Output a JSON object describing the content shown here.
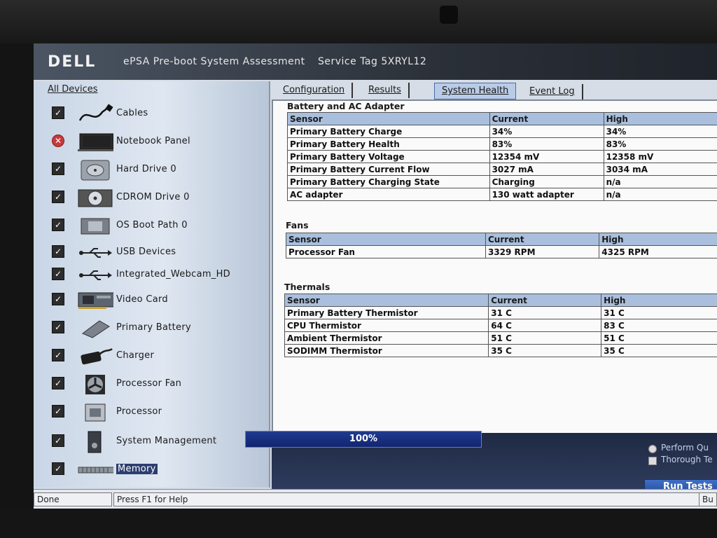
{
  "window": {
    "logo": "DELL",
    "title": "ePSA Pre-boot System Assessment",
    "service_tag": "Service Tag 5XRYL12"
  },
  "devices": {
    "header": "All Devices",
    "items": [
      {
        "label": "Cables",
        "status": "pass",
        "icon": "cable-icon"
      },
      {
        "label": "Notebook Panel",
        "status": "fail",
        "icon": "laptop-icon"
      },
      {
        "label": "Hard Drive 0",
        "status": "pass",
        "icon": "hard-drive-icon"
      },
      {
        "label": "CDROM Drive 0",
        "status": "pass",
        "icon": "cdrom-icon"
      },
      {
        "label": "OS Boot Path 0",
        "status": "pass",
        "icon": "boot-path-icon"
      },
      {
        "label": "USB Devices",
        "status": "pass",
        "icon": "usb-icon"
      },
      {
        "label": "Integrated_Webcam_HD",
        "status": "pass",
        "icon": "usb-icon"
      },
      {
        "label": "Video Card",
        "status": "pass",
        "icon": "video-card-icon"
      },
      {
        "label": "Primary Battery",
        "status": "pass",
        "icon": "battery-icon"
      },
      {
        "label": "Charger",
        "status": "pass",
        "icon": "charger-icon"
      },
      {
        "label": "Processor Fan",
        "status": "pass",
        "icon": "fan-icon"
      },
      {
        "label": "Processor",
        "status": "pass",
        "icon": "processor-icon"
      },
      {
        "label": "System Management",
        "status": "pass",
        "icon": "system-management-icon"
      },
      {
        "label": "Memory",
        "status": "pass",
        "icon": "memory-icon",
        "selected": true
      }
    ]
  },
  "tabs": [
    {
      "label": "Configuration"
    },
    {
      "label": "Results"
    },
    {
      "label": "System Health",
      "active": true
    },
    {
      "label": "Event Log"
    }
  ],
  "battery": {
    "title": "Battery and AC Adapter",
    "headers": [
      "Sensor",
      "Current",
      "High"
    ],
    "rows": [
      [
        "Primary Battery Charge",
        "34%",
        "34%"
      ],
      [
        "Primary Battery Health",
        "83%",
        "83%"
      ],
      [
        "Primary Battery Voltage",
        "12354 mV",
        "12358 mV"
      ],
      [
        "Primary Battery Current Flow",
        "3027 mA",
        "3034 mA"
      ],
      [
        "Primary Battery Charging State",
        "Charging",
        "n/a"
      ],
      [
        "AC adapter",
        "130 watt adapter",
        "n/a"
      ]
    ]
  },
  "fans": {
    "title": "Fans",
    "headers": [
      "Sensor",
      "Current",
      "High"
    ],
    "rows": [
      [
        "Processor Fan",
        "3329 RPM",
        "4325 RPM"
      ]
    ]
  },
  "thermals": {
    "title": "Thermals",
    "headers": [
      "Sensor",
      "Current",
      "High"
    ],
    "rows": [
      [
        "Primary Battery Thermistor",
        "31 C",
        "31 C"
      ],
      [
        "CPU Thermistor",
        "64 C",
        "83 C"
      ],
      [
        "Ambient Thermistor",
        "51 C",
        "51 C"
      ],
      [
        "SODIMM Thermistor",
        "35 C",
        "35 C"
      ]
    ]
  },
  "progress": {
    "label": "100%",
    "fraction": 1.0
  },
  "options": {
    "perform_quick": "Perform Qu",
    "thorough": "Thorough Te"
  },
  "run_button": "Run Tests",
  "status": {
    "left": "Done",
    "help": "Press F1 for Help",
    "right": "Bu"
  },
  "colors": {
    "selected_tab": "#b9cbe6",
    "table_header": "#a9bfdd",
    "progress_fill": "#1f3b8f",
    "fail": "#c8393b"
  }
}
